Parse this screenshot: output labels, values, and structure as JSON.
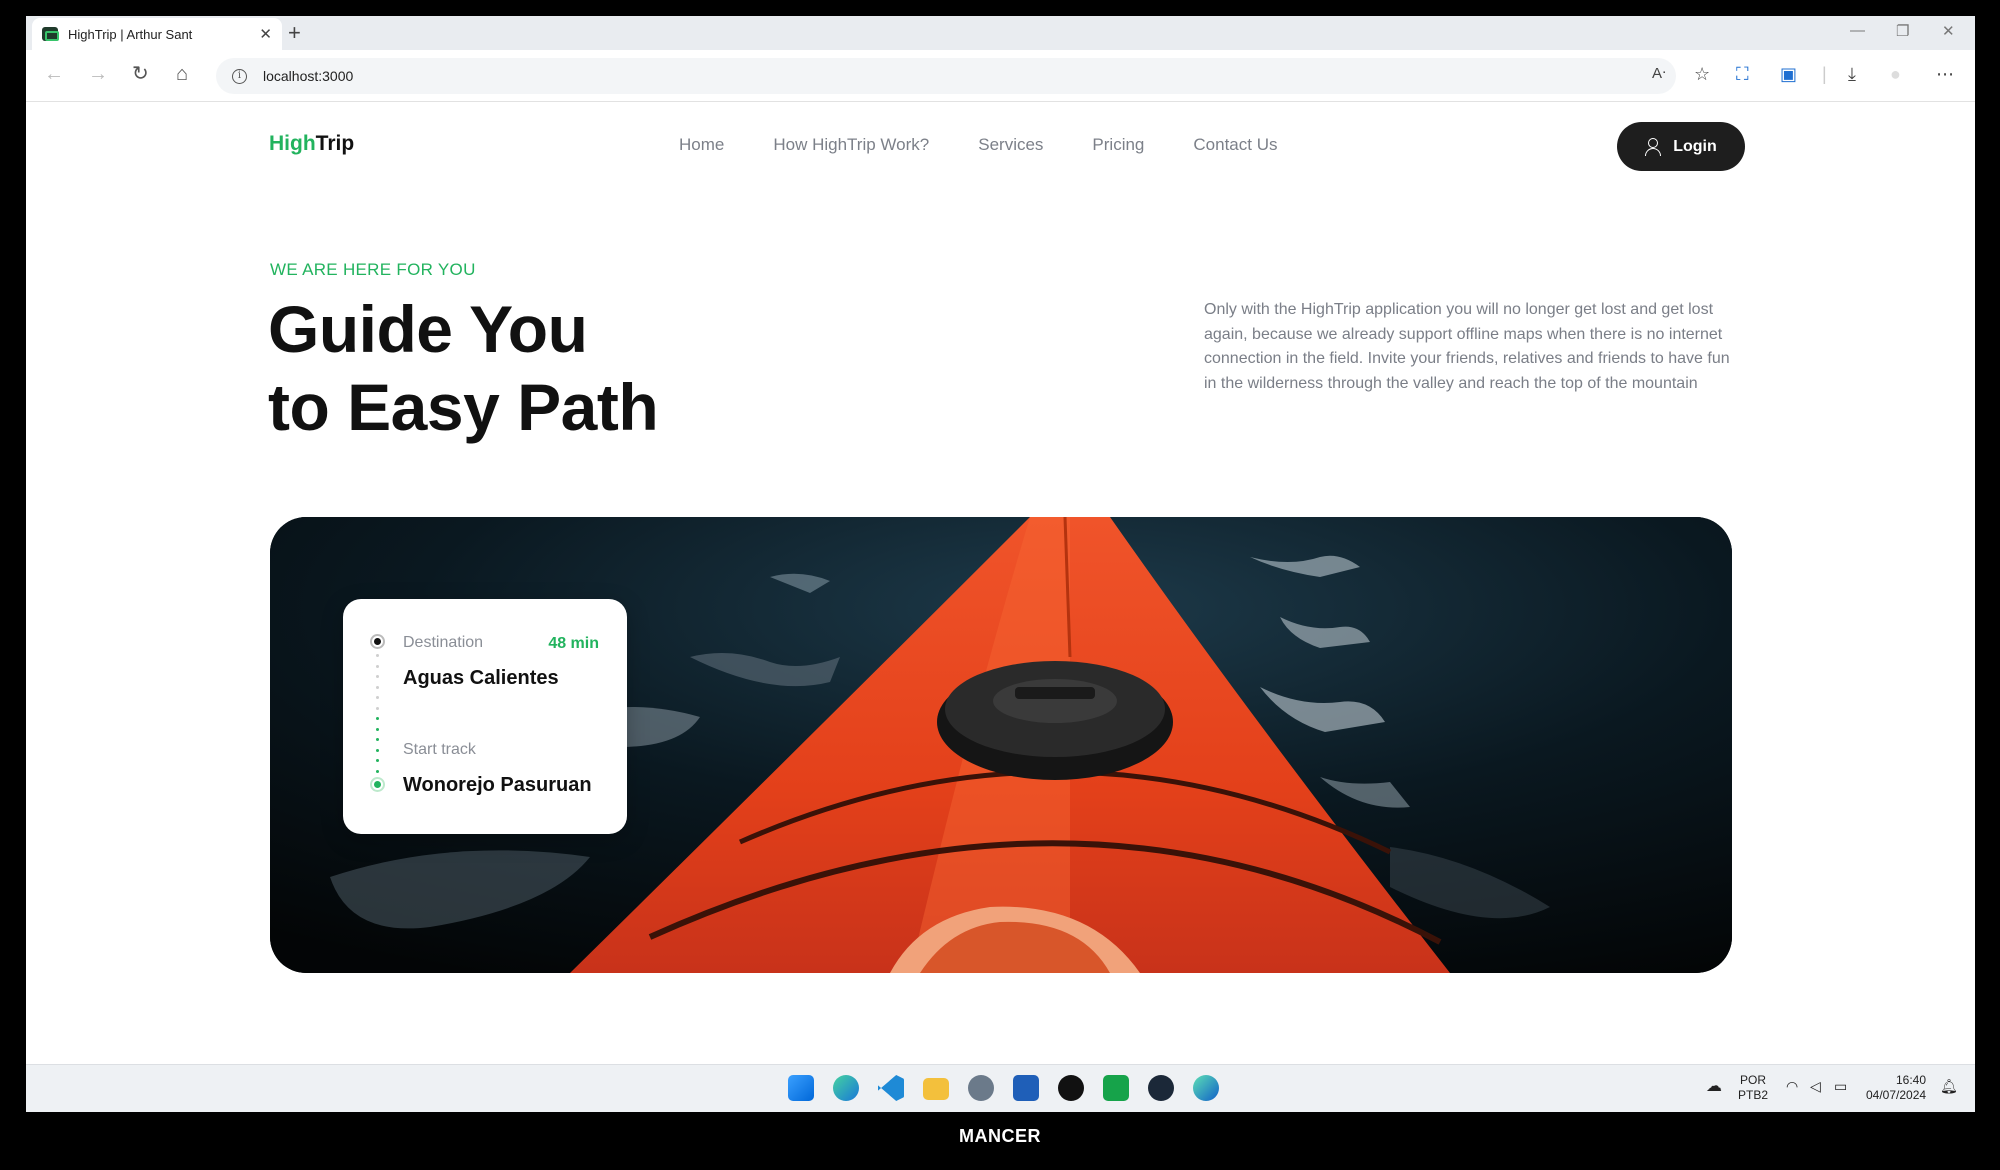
{
  "browser": {
    "tab_title": "HighTrip | Arthur Sant",
    "tab_close": "✕",
    "new_tab": "+",
    "url": "localhost:3000"
  },
  "site": {
    "logo_high": "High",
    "logo_trip": "Trip",
    "nav": [
      "Home",
      "How HighTrip Work?",
      "Services",
      "Pricing",
      "Contact Us"
    ],
    "login_label": "Login"
  },
  "hero": {
    "eyebrow": "WE ARE HERE FOR YOU",
    "headline_line1": "Guide You",
    "headline_line2": "to Easy Path",
    "description": "Only with the HighTrip application you will no longer get lost and get lost again, because we already support offline maps when there is no internet connection in the field. Invite your friends, relatives and friends to have fun in the wilderness through the valley and reach the top of the mountain"
  },
  "trip_card": {
    "destination_label": "Destination",
    "destination": "Aguas Calientes",
    "eta": "48 min",
    "start_label": "Start track",
    "start": "Wonorejo Pasuruan"
  },
  "taskbar": {
    "lang_line1": "POR",
    "lang_line2": "PTB2",
    "time": "16:40",
    "date": "04/07/2024",
    "apps": [
      "start-icon",
      "edge-icon",
      "vscode-icon",
      "file-explorer-icon",
      "settings-icon",
      "store-icon",
      "github-icon",
      "xbox-icon",
      "steam-icon",
      "edge-dev-icon"
    ]
  },
  "watermark": "MANCER",
  "colors": {
    "brand_green": "#22b35e",
    "dark": "#1e1e1e",
    "kayak_orange": "#e8431d"
  }
}
